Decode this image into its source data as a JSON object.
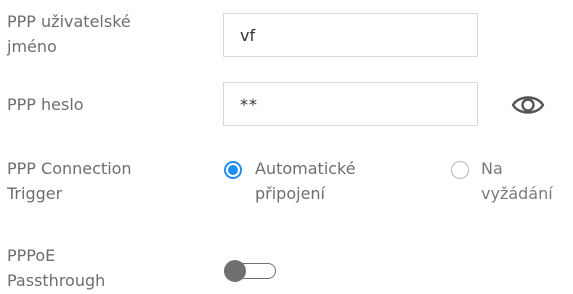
{
  "fields": {
    "username": {
      "label_line1": "PPP uživatelské",
      "label_line2": "jméno",
      "value": "vf"
    },
    "password": {
      "label": "PPP heslo",
      "value": "**",
      "reveal_icon": "eye-icon"
    },
    "connection_trigger": {
      "label_line1": "PPP Connection",
      "label_line2": "Trigger",
      "options": [
        {
          "line1": "Automatické",
          "line2": "připojení",
          "selected": true
        },
        {
          "line1": "Na",
          "line2": "vyžádání",
          "selected": false
        }
      ]
    },
    "pppoe_passthrough": {
      "label_line1": "PPPoE",
      "label_line2": "Passthrough",
      "enabled": false
    }
  },
  "colors": {
    "accent": "#1e8ff0",
    "label_text": "#6e6e6e",
    "toggle_off": "#707070",
    "input_border": "#d8d8d8"
  }
}
